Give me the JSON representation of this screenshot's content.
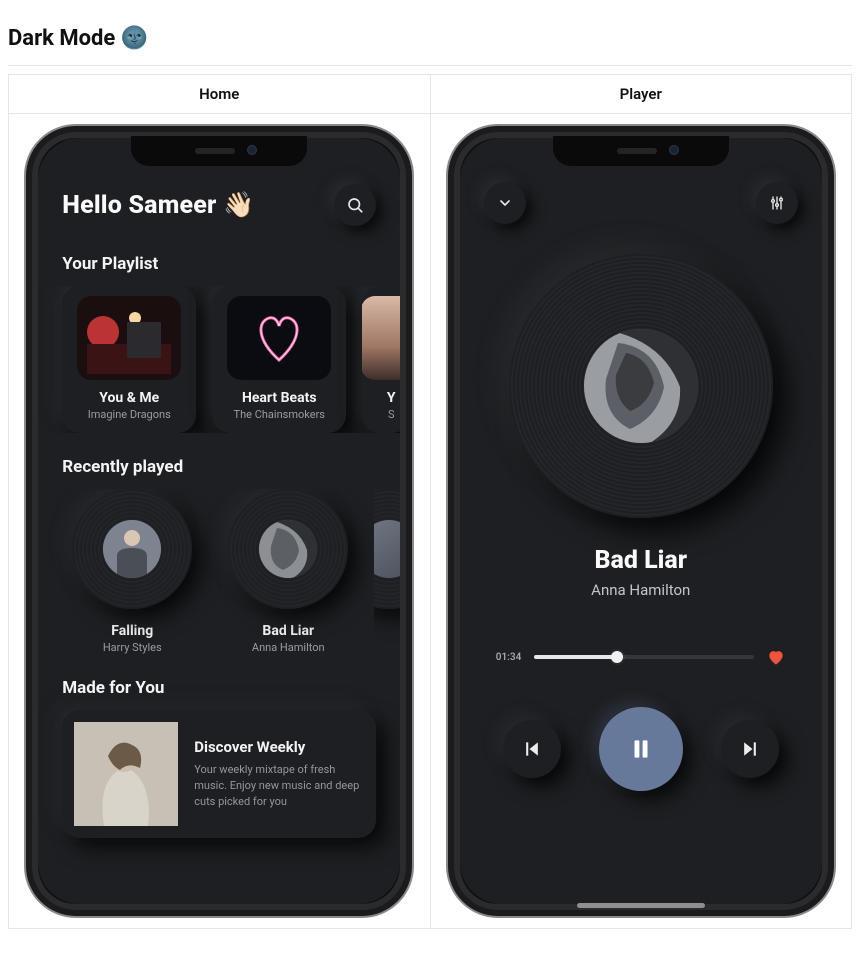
{
  "page": {
    "title": "Dark Mode",
    "emoji": "🌚"
  },
  "columns": {
    "home_label": "Home",
    "player_label": "Player"
  },
  "home": {
    "greeting_prefix": "Hello",
    "greeting_name": "Sameer",
    "wave_emoji": "👋🏻",
    "section_playlist": "Your Playlist",
    "section_recent": "Recently played",
    "section_made": "Made for You",
    "playlist": [
      {
        "title": "You & Me",
        "artist": "Imagine Dragons",
        "img_hint": "concert-red"
      },
      {
        "title": "Heart Beats",
        "artist": "The Chainsmokers",
        "img_hint": "sparkler-heart"
      },
      {
        "title": "Y",
        "artist": "S",
        "img_hint": "sunset-partial"
      }
    ],
    "recent": [
      {
        "title": "Falling",
        "artist": "Harry Styles",
        "img_hint": "man-jacket"
      },
      {
        "title": "Bad Liar",
        "artist": "Anna Hamilton",
        "img_hint": "woman-hair"
      }
    ],
    "made_for_you": {
      "title": "Discover Weekly",
      "description": "Your weekly mixtape of fresh music. Enjoy new music and deep cuts picked for you",
      "img_hint": "woman-hoodie"
    }
  },
  "player": {
    "song_title": "Bad Liar",
    "song_artist": "Anna Hamilton",
    "elapsed_time": "01:34",
    "progress_percent": 38,
    "favorited": true,
    "is_playing": true,
    "album_img_hint": "woman-hair"
  },
  "colors": {
    "bg": "#1d1f22",
    "accent_play": "#67799a",
    "heart": "#f0523c"
  }
}
